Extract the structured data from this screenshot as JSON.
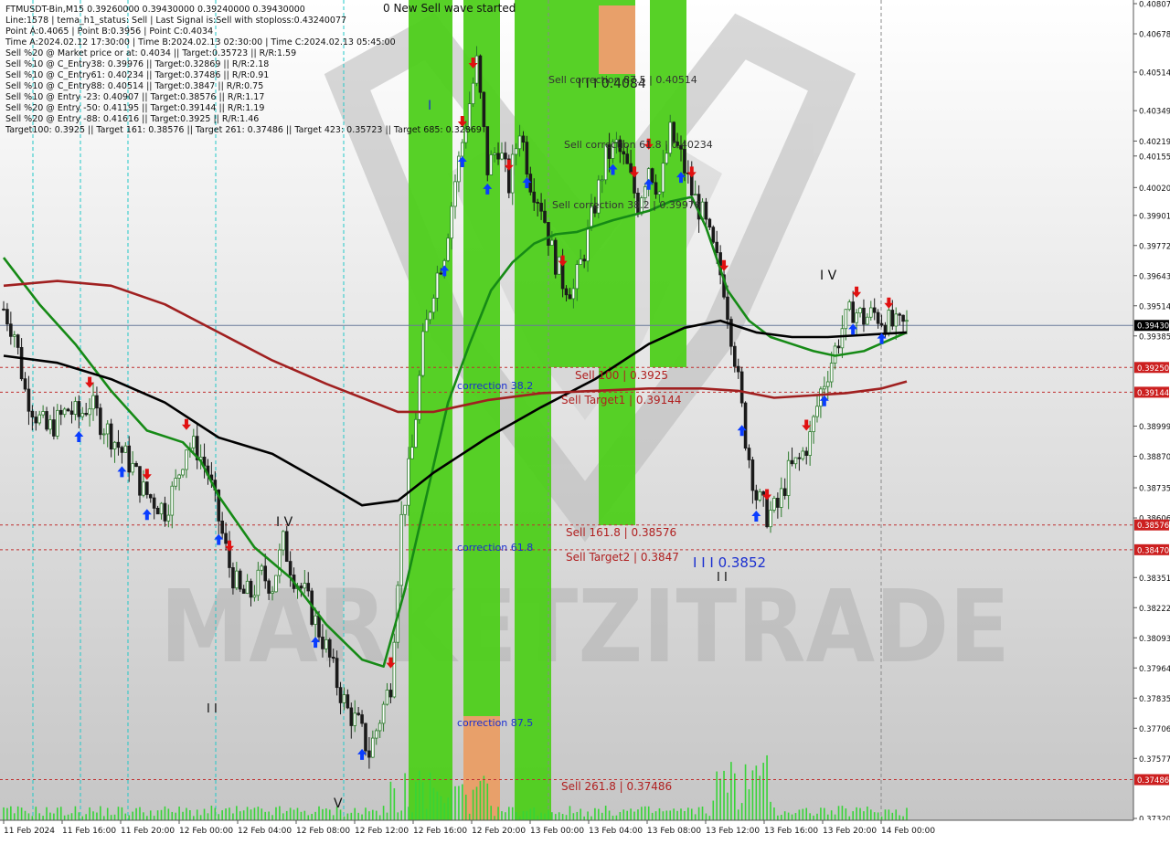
{
  "header": {
    "lines": [
      "FTMUSDT-Bin,M15  0.39260000 0.39430000 0.39240000 0.39430000",
      "Line:1578 | tema_h1_status: Sell | Last Signal is:Sell with stoploss:0.43240077",
      "Point A:0.4065 | Point B:0.3956 | Point C:0.4034",
      "Time A:2024.02.12 17:30:00 | Time B:2024.02.13 02:30:00 | Time C:2024.02.13 05:45:00",
      "Sell %20 @ Market price or at: 0.4034 || Target:0.35723 || R/R:1.59",
      "Sell %10 @ C_Entry38: 0.39976 || Target:0.32869 || R/R:2.18",
      "Sell %10 @ C_Entry61: 0.40234 || Target:0.37486 || R/R:0.91",
      "Sell %10 @ C_Entry88: 0.40514 || Target:0.3847 || R/R:0.75",
      "Sell %10 @ Entry -23: 0.40907 || Target:0.38576 || R/R:1.17",
      "Sell %20 @ Entry -50: 0.41195 || Target:0.39144 || R/R:1.19",
      "Sell %20 @ Entry -88: 0.41616 || Target:0.3925 || R/R:1.46",
      "Target100: 0.3925 || Target 161: 0.38576 || Target 261: 0.37486 || Target 423: 0.35723 || Target 685: 0.32869"
    ]
  },
  "annotations": {
    "wave_started": "0 New Sell wave started",
    "sell_corr_875": "Sell correction 87.5 | 0.40514",
    "sell_corr_618": "Sell correction 61.8 | 0.40234",
    "sell_corr_382": "Sell correction 38.2 | 0.39976",
    "big_label": "I I I 0.4084",
    "correction_382": "correction 38.2",
    "correction_618": "correction 61.8",
    "correction_875": "correction 87.5",
    "sell_100": "Sell 100 | 0.3925",
    "sell_target1": "Sell Target1 | 0.39144",
    "sell_161": "Sell 161.8 | 0.38576",
    "sell_target2": "Sell Target2 | 0.3847",
    "sell_261": "Sell 261.8 | 0.37486",
    "wave_label_b": "I I I 0.3852",
    "wave_iv_a": "I V",
    "wave_iv_b": "I V",
    "wave_v": "V",
    "wave_i": "I",
    "wave_ii_a": "I I",
    "wave_ii_b": "I I",
    "watermark": "MARKETZITRADE"
  },
  "colors": {
    "background": "#ffffff",
    "plot_bg_top": "#ffffff",
    "plot_bg_bottom": "#c9c9c9",
    "green_zone": "#4ecf1b",
    "orange_zone": "#e8a06a",
    "candle_bull": "#2a7a2a",
    "candle_bear": "#1a1a1a",
    "ma_green": "#168a16",
    "ma_black": "#000000",
    "ma_darkred": "#a02020",
    "level_line": "#c03030",
    "current_price_line": "#6a7a9a",
    "volume": "#37d437",
    "arrow_up": "#0a3dff",
    "arrow_down": "#e01010",
    "axis_text": "#111111",
    "price_tag_red": "#cc2020",
    "price_tag_dark": "#000000"
  },
  "chart_data": {
    "type": "candlestick",
    "symbol": "FTMUSDT-Bin",
    "timeframe": "M15",
    "ylim": [
      0.3732,
      0.40807
    ],
    "y_ticks": [
      "0.40807",
      "0.40678",
      "0.40514",
      "0.40349",
      "0.40219",
      "0.40155",
      "0.40020",
      "0.39901",
      "0.39772",
      "0.39643",
      "0.39514",
      "0.39385",
      "0.38999",
      "0.38870",
      "0.38735",
      "0.38606",
      "0.38351",
      "0.38222",
      "0.38093",
      "0.37964",
      "0.37835",
      "0.37706",
      "0.37577",
      "0.37320"
    ],
    "price_tags": [
      {
        "label": "0.39430",
        "kind": "current"
      },
      {
        "label": "0.39250",
        "kind": "level"
      },
      {
        "label": "0.39144",
        "kind": "level"
      },
      {
        "label": "0.38576",
        "kind": "level"
      },
      {
        "label": "0.38470",
        "kind": "level"
      },
      {
        "label": "0.37486",
        "kind": "level"
      }
    ],
    "levels": [
      0.3925,
      0.39144,
      0.38576,
      0.3847,
      0.37486
    ],
    "current_price": 0.3943,
    "x_labels": [
      "11 Feb 2024",
      "11 Feb 16:00",
      "11 Feb 20:00",
      "12 Feb 00:00",
      "12 Feb 04:00",
      "12 Feb 08:00",
      "12 Feb 12:00",
      "12 Feb 16:00",
      "12 Feb 20:00",
      "13 Feb 00:00",
      "13 Feb 04:00",
      "13 Feb 08:00",
      "13 Feb 12:00",
      "13 Feb 16:00",
      "13 Feb 20:00",
      "14 Feb 00:00"
    ],
    "close_path": [
      [
        0,
        0.395
      ],
      [
        3,
        0.394
      ],
      [
        6,
        0.3915
      ],
      [
        9,
        0.3905
      ],
      [
        12,
        0.3898
      ],
      [
        15,
        0.3902
      ],
      [
        18,
        0.3907
      ],
      [
        21,
        0.3904
      ],
      [
        24,
        0.391
      ],
      [
        27,
        0.3902
      ],
      [
        30,
        0.3896
      ],
      [
        33,
        0.3889
      ],
      [
        36,
        0.3882
      ],
      [
        39,
        0.3872
      ],
      [
        42,
        0.3868
      ],
      [
        45,
        0.3864
      ],
      [
        48,
        0.3875
      ],
      [
        51,
        0.3892
      ],
      [
        54,
        0.389
      ],
      [
        57,
        0.388
      ],
      [
        60,
        0.386
      ],
      [
        63,
        0.384
      ],
      [
        66,
        0.3828
      ],
      [
        69,
        0.3828
      ],
      [
        72,
        0.3836
      ],
      [
        75,
        0.3832
      ],
      [
        78,
        0.385
      ],
      [
        81,
        0.3836
      ],
      [
        84,
        0.3828
      ],
      [
        87,
        0.3816
      ],
      [
        90,
        0.3805
      ],
      [
        93,
        0.379
      ],
      [
        96,
        0.3778
      ],
      [
        99,
        0.3772
      ],
      [
        102,
        0.376
      ],
      [
        105,
        0.3775
      ],
      [
        108,
        0.379
      ],
      [
        111,
        0.386
      ],
      [
        114,
        0.389
      ],
      [
        117,
        0.3935
      ],
      [
        120,
        0.396
      ],
      [
        123,
        0.3975
      ],
      [
        126,
        0.4005
      ],
      [
        129,
        0.403
      ],
      [
        132,
        0.4055
      ],
      [
        135,
        0.401
      ],
      [
        138,
        0.402
      ],
      [
        141,
        0.4003
      ],
      [
        144,
        0.4028
      ],
      [
        147,
        0.4005
      ],
      [
        150,
        0.3995
      ],
      [
        153,
        0.3975
      ],
      [
        156,
        0.3962
      ],
      [
        159,
        0.3958
      ],
      [
        162,
        0.3975
      ],
      [
        165,
        0.3995
      ],
      [
        168,
        0.4015
      ],
      [
        171,
        0.402
      ],
      [
        174,
        0.401
      ],
      [
        177,
        0.3995
      ],
      [
        180,
        0.4012
      ],
      [
        183,
        0.4
      ],
      [
        186,
        0.4025
      ],
      [
        189,
        0.4015
      ],
      [
        192,
        0.4
      ],
      [
        195,
        0.399
      ],
      [
        198,
        0.3975
      ],
      [
        201,
        0.396
      ],
      [
        204,
        0.393
      ],
      [
        207,
        0.3895
      ],
      [
        210,
        0.387
      ],
      [
        213,
        0.3862
      ],
      [
        216,
        0.3865
      ],
      [
        219,
        0.388
      ],
      [
        222,
        0.3885
      ],
      [
        225,
        0.3895
      ],
      [
        228,
        0.3915
      ],
      [
        231,
        0.3928
      ],
      [
        234,
        0.3942
      ],
      [
        237,
        0.395
      ],
      [
        240,
        0.3946
      ],
      [
        243,
        0.3948
      ],
      [
        246,
        0.3945
      ],
      [
        249,
        0.3942
      ],
      [
        252,
        0.3943
      ]
    ],
    "moving_averages": [
      {
        "name": "green",
        "color": "#168a16",
        "points": [
          [
            0,
            0.3972
          ],
          [
            10,
            0.3952
          ],
          [
            20,
            0.3935
          ],
          [
            30,
            0.3915
          ],
          [
            40,
            0.3898
          ],
          [
            50,
            0.3893
          ],
          [
            55,
            0.3885
          ],
          [
            60,
            0.387
          ],
          [
            70,
            0.3848
          ],
          [
            80,
            0.3835
          ],
          [
            90,
            0.3815
          ],
          [
            100,
            0.38
          ],
          [
            106,
            0.3797
          ],
          [
            112,
            0.383
          ],
          [
            118,
            0.387
          ],
          [
            124,
            0.391
          ],
          [
            130,
            0.3935
          ],
          [
            136,
            0.3958
          ],
          [
            142,
            0.397
          ],
          [
            148,
            0.3978
          ],
          [
            154,
            0.3982
          ],
          [
            160,
            0.3983
          ],
          [
            170,
            0.3988
          ],
          [
            180,
            0.3992
          ],
          [
            186,
            0.3996
          ],
          [
            192,
            0.3998
          ],
          [
            196,
            0.3985
          ],
          [
            202,
            0.3958
          ],
          [
            208,
            0.3945
          ],
          [
            214,
            0.3938
          ],
          [
            220,
            0.3935
          ],
          [
            226,
            0.3932
          ],
          [
            232,
            0.393
          ],
          [
            240,
            0.3932
          ],
          [
            252,
            0.394
          ]
        ]
      },
      {
        "name": "black",
        "color": "#000000",
        "points": [
          [
            0,
            0.393
          ],
          [
            15,
            0.3927
          ],
          [
            30,
            0.392
          ],
          [
            45,
            0.391
          ],
          [
            60,
            0.3895
          ],
          [
            75,
            0.3888
          ],
          [
            90,
            0.3875
          ],
          [
            100,
            0.3866
          ],
          [
            110,
            0.3868
          ],
          [
            120,
            0.388
          ],
          [
            135,
            0.3895
          ],
          [
            150,
            0.3908
          ],
          [
            165,
            0.392
          ],
          [
            180,
            0.3935
          ],
          [
            190,
            0.3942
          ],
          [
            200,
            0.3945
          ],
          [
            210,
            0.394
          ],
          [
            220,
            0.3938
          ],
          [
            230,
            0.3938
          ],
          [
            252,
            0.394
          ]
        ]
      },
      {
        "name": "darkred",
        "color": "#a02020",
        "points": [
          [
            0,
            0.396
          ],
          [
            15,
            0.3962
          ],
          [
            30,
            0.396
          ],
          [
            45,
            0.3952
          ],
          [
            60,
            0.394
          ],
          [
            75,
            0.3928
          ],
          [
            90,
            0.3918
          ],
          [
            100,
            0.3912
          ],
          [
            110,
            0.3906
          ],
          [
            120,
            0.3906
          ],
          [
            135,
            0.3911
          ],
          [
            150,
            0.3914
          ],
          [
            165,
            0.3915
          ],
          [
            180,
            0.3916
          ],
          [
            195,
            0.3916
          ],
          [
            205,
            0.3915
          ],
          [
            215,
            0.3912
          ],
          [
            225,
            0.3913
          ],
          [
            235,
            0.3914
          ],
          [
            245,
            0.3916
          ],
          [
            252,
            0.3919
          ]
        ]
      }
    ]
  }
}
